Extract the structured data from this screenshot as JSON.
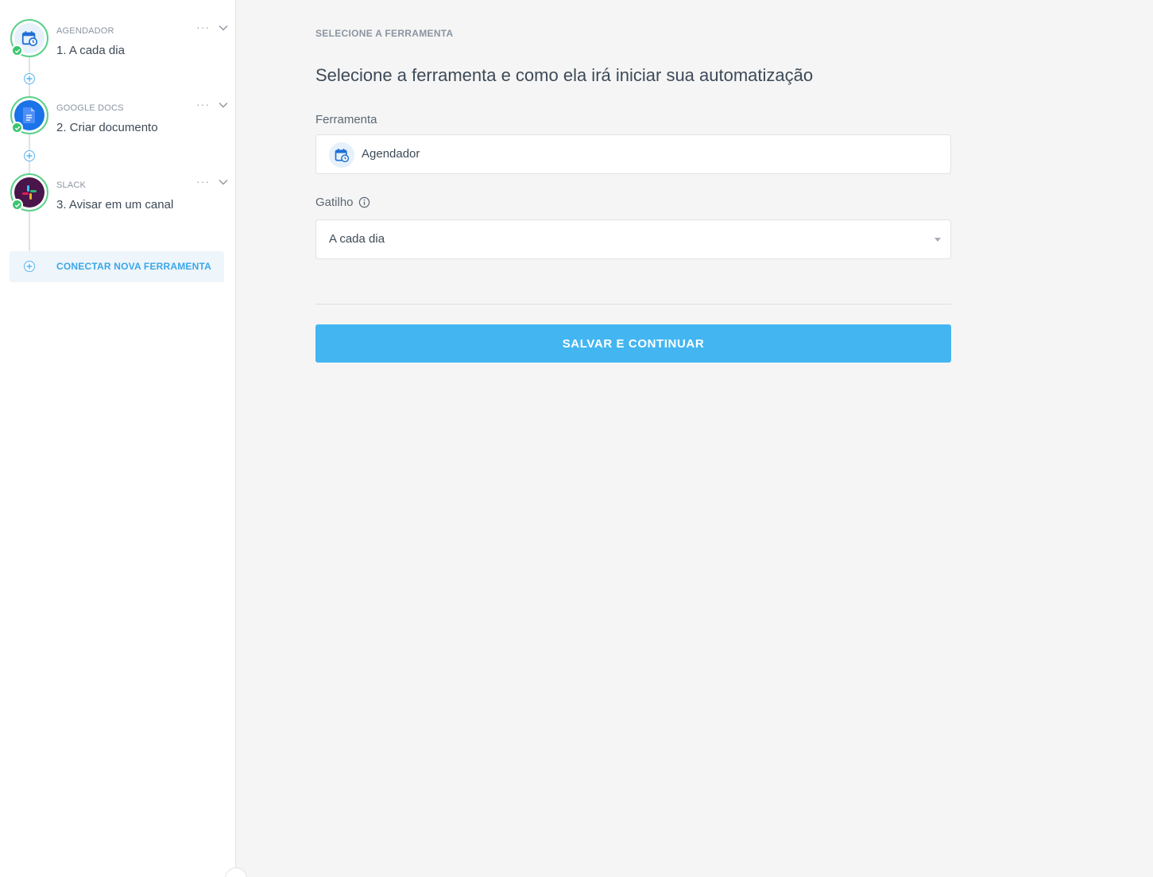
{
  "sidebar": {
    "steps": [
      {
        "kicker": "AGENDADOR",
        "title": "1. A cada dia",
        "icon": "calendar-clock-icon",
        "status": "completed"
      },
      {
        "kicker": "GOOGLE DOCS",
        "title": "2. Criar documento",
        "icon": "google-docs-icon",
        "status": "completed"
      },
      {
        "kicker": "SLACK",
        "title": "3. Avisar em um canal",
        "icon": "slack-icon",
        "status": "completed"
      }
    ],
    "more_glyph": "···",
    "connect_label": "CONECTAR NOVA FERRAMENTA"
  },
  "main": {
    "kicker": "SELECIONE A FERRAMENTA",
    "heading": "Selecione a ferramenta e como ela irá iniciar sua automatização",
    "tool_field": {
      "label": "Ferramenta",
      "value": "Agendador",
      "icon": "calendar-clock-icon"
    },
    "trigger_field": {
      "label": "Gatilho",
      "value": "A cada dia",
      "info_icon": "info-icon"
    },
    "submit_label": "SALVAR E CONTINUAR"
  },
  "colors": {
    "accent": "#43b6f1",
    "success": "#3cc46e",
    "link": "#3aa7e8"
  }
}
